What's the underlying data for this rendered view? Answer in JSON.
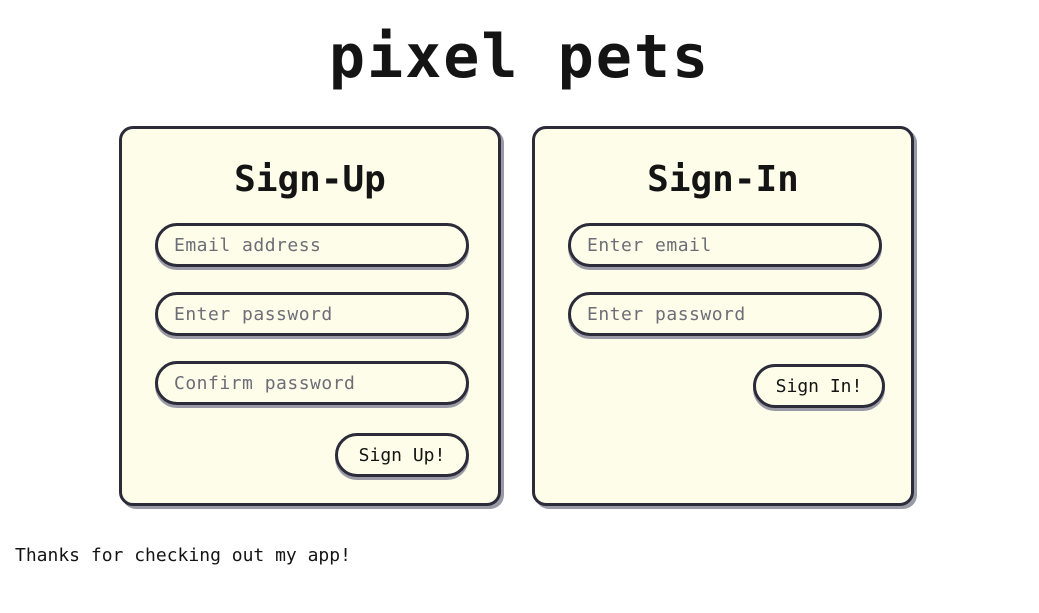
{
  "app": {
    "title": "pixel pets"
  },
  "signup": {
    "title": "Sign-Up",
    "email_placeholder": "Email address",
    "password_placeholder": "Enter password",
    "confirm_placeholder": "Confirm password",
    "submit_label": "Sign Up!"
  },
  "signin": {
    "title": "Sign-In",
    "email_placeholder": "Enter email",
    "password_placeholder": "Enter password",
    "submit_label": "Sign In!"
  },
  "footer": {
    "text": "Thanks for checking out my app!"
  },
  "colors": {
    "card_background": "#fefde9",
    "border": "#2b2b3a",
    "shadow": "#9a9aa6",
    "text": "#141414"
  }
}
